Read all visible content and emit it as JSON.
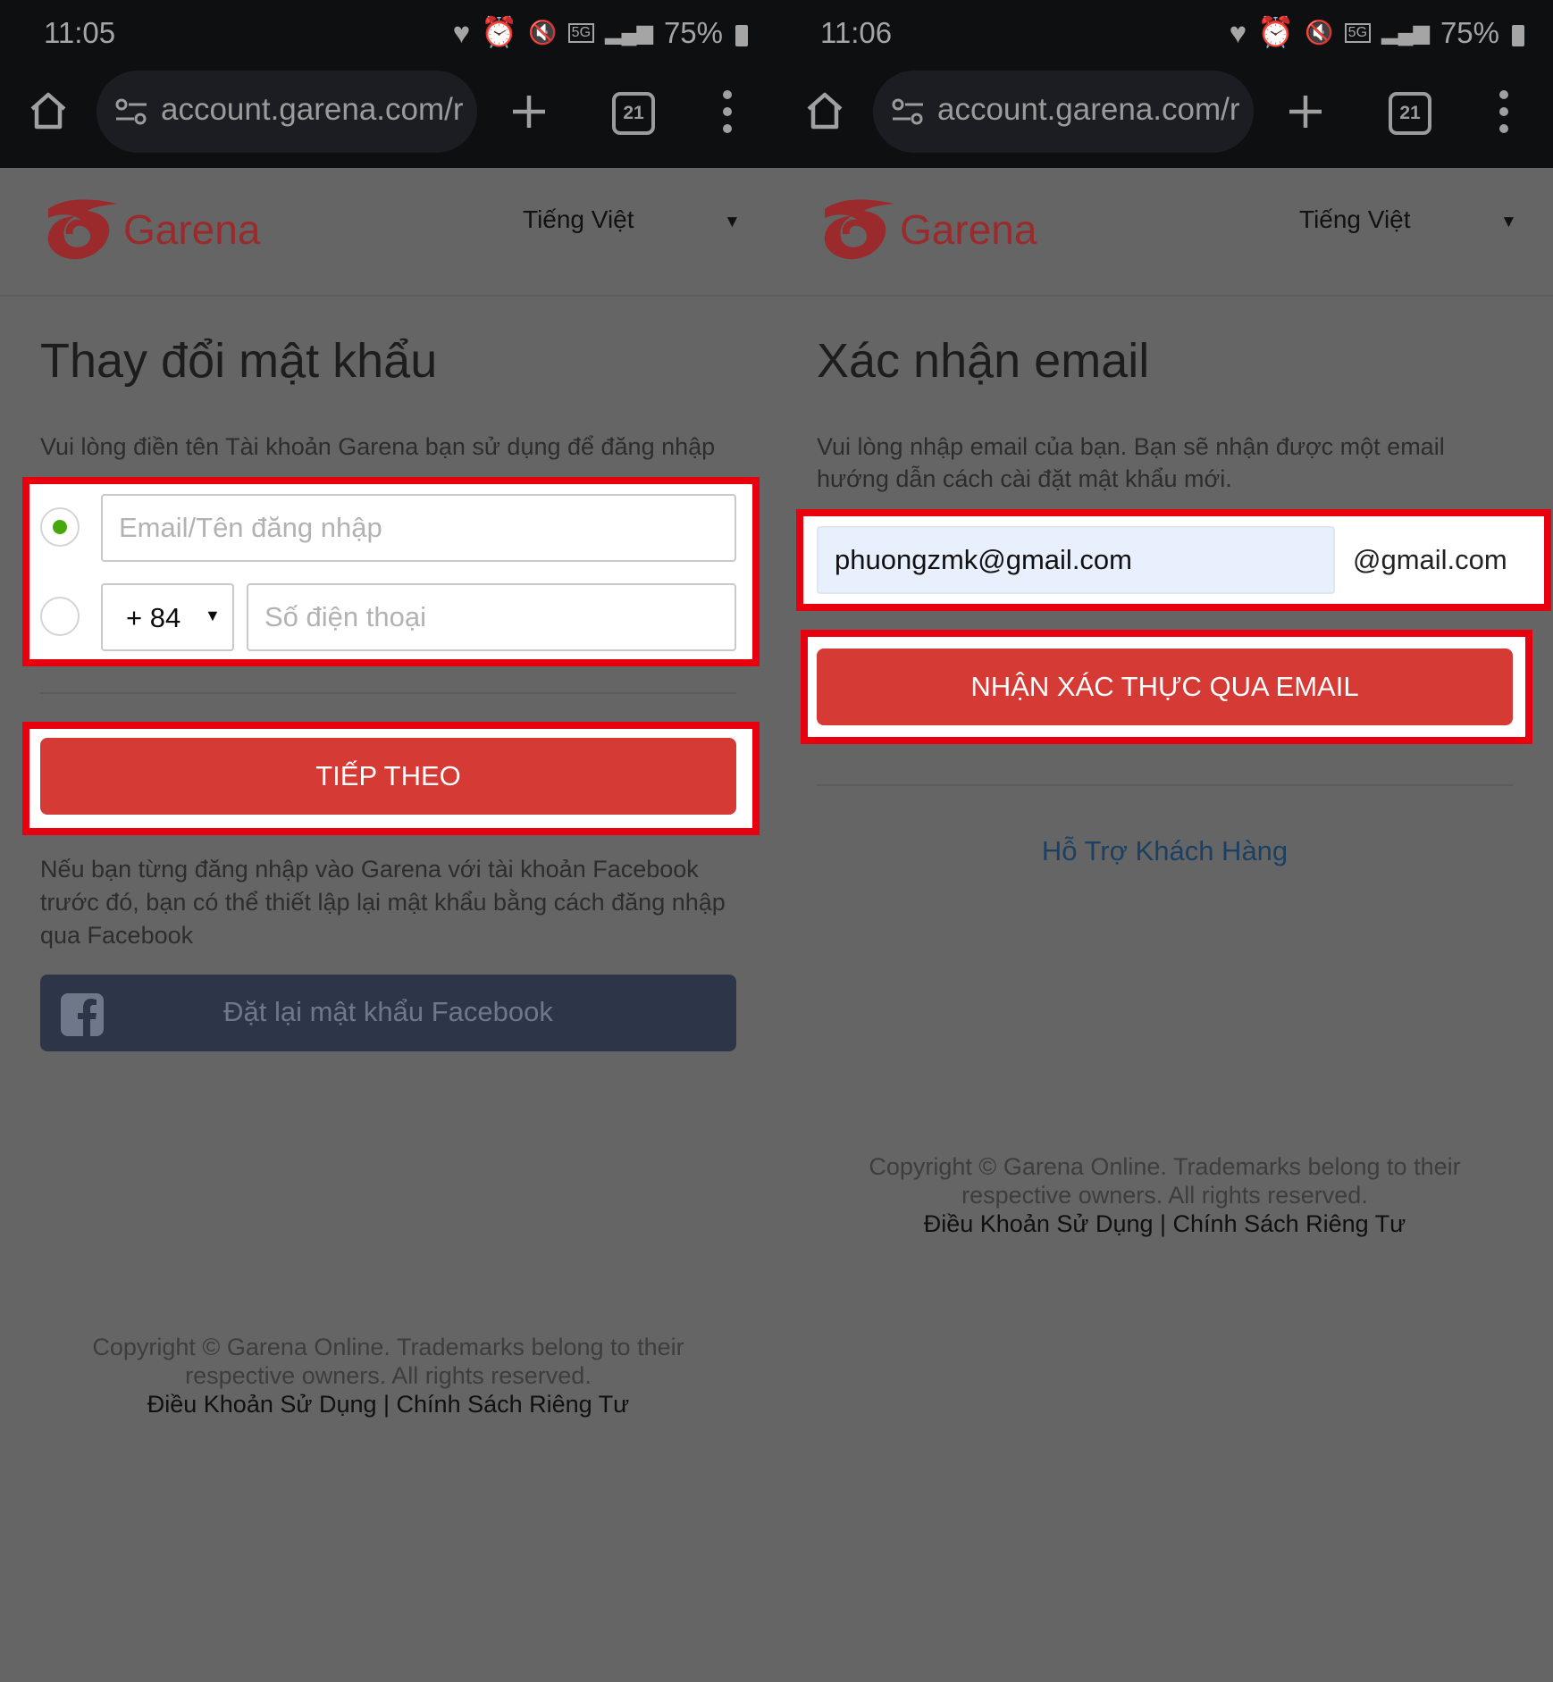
{
  "left": {
    "status": {
      "time": "11:05",
      "battery": "75%",
      "network": "5G"
    },
    "browser": {
      "url": "account.garena.com/r",
      "tab_count": "21"
    },
    "header": {
      "logo": "Garena",
      "language": "Tiếng Việt"
    },
    "title": "Thay đổi mật khẩu",
    "description": "Vui lòng điền tên Tài khoản Garena bạn sử dụng để đăng nhập",
    "form": {
      "email_placeholder": "Email/Tên đăng nhập",
      "country_code": "+ 84",
      "phone_placeholder": "Số điện thoại"
    },
    "next_button": "TIẾP THEO",
    "facebook_note": "Nếu bạn từng đăng nhập vào Garena với tài khoản Facebook trước đó, bạn có thể thiết lập lại mật khẩu bằng cách đăng nhập qua Facebook",
    "facebook_button": "Đặt lại mật khẩu Facebook",
    "footer": {
      "copyright_line1": "Copyright © Garena Online. Trademarks belong to their",
      "copyright_line2": "respective owners. All rights reserved.",
      "terms": "Điều Khoản Sử Dụng",
      "separator": " | ",
      "privacy": "Chính Sách Riêng Tư"
    }
  },
  "right": {
    "status": {
      "time": "11:06",
      "battery": "75%",
      "network": "5G"
    },
    "browser": {
      "url": "account.garena.com/r",
      "tab_count": "21"
    },
    "header": {
      "logo": "Garena",
      "language": "Tiếng Việt"
    },
    "title": "Xác nhận email",
    "description": "Vui lòng nhập email của bạn. Bạn sẽ nhận được một email hướng dẫn cách cài đặt mật khẩu mới.",
    "email_value": "phuongzmk@gmail.com",
    "email_suffix": "@gmail.com",
    "submit_button": "NHẬN XÁC THỰC QUA EMAIL",
    "support_link": "Hỗ Trợ Khách Hàng",
    "footer": {
      "copyright_line1": "Copyright © Garena Online. Trademarks belong to their",
      "copyright_line2": "respective owners. All rights reserved.",
      "terms": "Điều Khoản Sử Dụng",
      "separator": " | ",
      "privacy": "Chính Sách Riêng Tư"
    }
  },
  "colors": {
    "highlight": "#e8000f",
    "button_red": "#a6322e",
    "overlay_bg": "#656565",
    "facebook": "#2d3648"
  }
}
